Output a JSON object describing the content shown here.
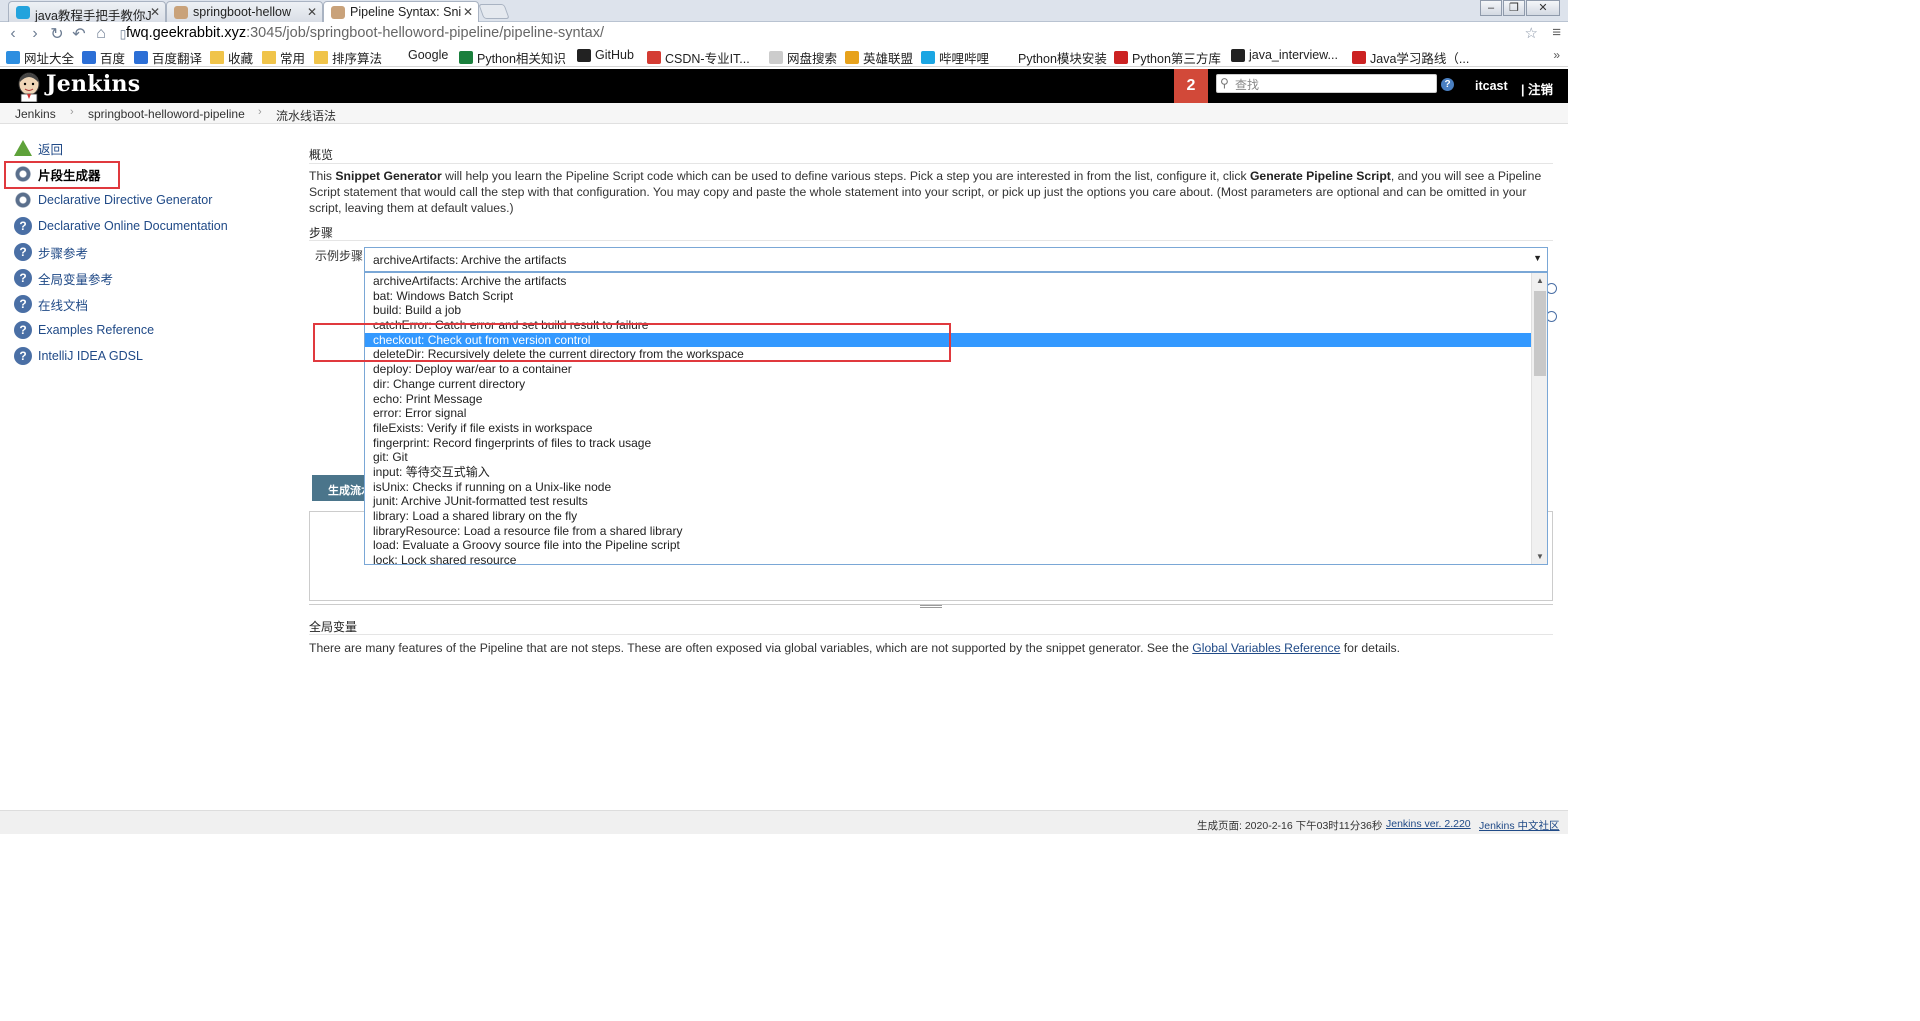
{
  "browser": {
    "tabs": [
      {
        "title": "java教程手把手教你J",
        "active": false
      },
      {
        "title": "springboot-hellow",
        "active": false
      },
      {
        "title": "Pipeline Syntax: Sni",
        "active": true
      }
    ],
    "url_host": "fwq.geekrabbit.xyz",
    "url_path": ":3045/job/springboot-helloword-pipeline/pipeline-syntax/",
    "bookmarks": [
      "网址大全",
      "百度",
      "百度翻译",
      "收藏",
      "常用",
      "排序算法",
      "Google",
      "Python相关知识",
      "GitHub",
      "CSDN-专业IT...",
      "网盘搜索",
      "英雄联盟",
      "哔哩哔哩",
      "Python模块安装",
      "Python第三方库",
      "java_interview...",
      "Java学习路线（..."
    ],
    "more_bookmarks": "»"
  },
  "header": {
    "title": "Jenkins",
    "notification_count": "2",
    "search_placeholder": "查找",
    "help": "?",
    "user": "itcast",
    "logout": "| 注销"
  },
  "breadcrumb": [
    "Jenkins",
    "springboot-helloword-pipeline",
    "流水线语法"
  ],
  "sidebar": {
    "items": [
      {
        "label": "返回",
        "icon": "up-arrow-icon"
      },
      {
        "label": "片段生成器",
        "icon": "gear-icon"
      },
      {
        "label": "Declarative Directive Generator",
        "icon": "gear-icon"
      },
      {
        "label": "Declarative Online Documentation",
        "icon": "help-icon"
      },
      {
        "label": "步骤参考",
        "icon": "help-icon"
      },
      {
        "label": "全局变量参考",
        "icon": "help-icon"
      },
      {
        "label": "在线文档",
        "icon": "help-icon"
      },
      {
        "label": "Examples Reference",
        "icon": "help-icon"
      },
      {
        "label": "IntelliJ IDEA GDSL",
        "icon": "help-icon"
      }
    ]
  },
  "main": {
    "overview_title": "概览",
    "intro_pre": "This ",
    "intro_b1": "Snippet Generator",
    "intro_mid": " will help you learn the Pipeline Script code which can be used to define various steps. Pick a step you are interested in from the list, configure it, click ",
    "intro_b2": "Generate Pipeline Script",
    "intro_post": ", and you will see a Pipeline Script statement that would call the step with that configuration. You may copy and paste the whole statement into your script, or pick up just the options you care about. (Most parameters are optional and can be omitted in your script, leaving them at default values.)",
    "steps_title": "步骤",
    "step_label": "示例步骤",
    "selected_step": "archiveArtifacts: Archive the artifacts",
    "dropdown_options": [
      "archiveArtifacts: Archive the artifacts",
      "bat: Windows Batch Script",
      "build: Build a job",
      "catchError: Catch error and set build result to failure",
      "checkout: Check out from version control",
      "deleteDir: Recursively delete the current directory from the workspace",
      "deploy: Deploy war/ear to a container",
      "dir: Change current directory",
      "echo: Print Message",
      "error: Error signal",
      "fileExists: Verify if file exists in workspace",
      "fingerprint: Record fingerprints of files to track usage",
      "git: Git",
      "input: 等待交互式输入",
      "isUnix: Checks if running on a Unix-like node",
      "junit: Archive JUnit-formatted test results",
      "library: Load a shared library on the fly",
      "libraryResource: Load a resource file from a shared library",
      "load: Evaluate a Groovy source file into the Pipeline script",
      "lock: Lock shared resource"
    ],
    "highlighted_index": 4,
    "generate_button": "生成流水线脚本",
    "global_title": "全局变量",
    "global_pre": "There are many features of the Pipeline that are not steps. These are often exposed via global variables, which are not supported by the snippet generator. See the ",
    "global_link": "Global Variables Reference",
    "global_post": " for details."
  },
  "footer": {
    "generated": "生成页面: 2020-2-16 下午03时11分36秒",
    "version": "Jenkins ver. 2.220",
    "community": "Jenkins 中文社区"
  },
  "colors": {
    "highlight": "#3399ff",
    "annotation_red": "#e0393e",
    "badge": "#d24939",
    "button": "#4b758b"
  }
}
